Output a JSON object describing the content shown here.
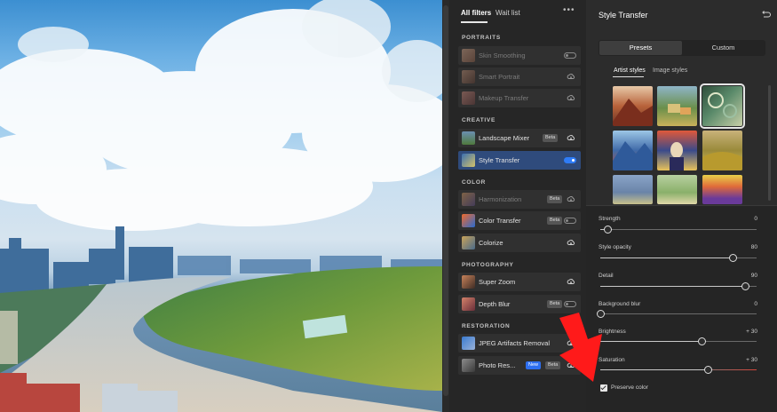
{
  "colors": {
    "accent": "#2f7cf6",
    "arrow": "#ff1a1a",
    "selected_row": "#2f4b7c"
  },
  "filters_panel": {
    "tabs": [
      {
        "label": "All filters",
        "active": true
      },
      {
        "label": "Wait list",
        "active": false
      }
    ],
    "more_icon": "more-horizontal-icon",
    "sections": [
      {
        "title": "PORTRAITS",
        "items": [
          {
            "label": "Skin Smoothing",
            "state": "toggle-off",
            "dim": true
          },
          {
            "label": "Smart Portrait",
            "state": "cloud",
            "dim": true
          },
          {
            "label": "Makeup Transfer",
            "state": "cloud",
            "dim": true
          }
        ]
      },
      {
        "title": "CREATIVE",
        "items": [
          {
            "label": "Landscape Mixer",
            "badge": "Beta",
            "state": "cloud"
          },
          {
            "label": "Style Transfer",
            "state": "toggle-on",
            "selected": true
          }
        ]
      },
      {
        "title": "COLOR",
        "items": [
          {
            "label": "Harmonization",
            "badge": "Beta",
            "state": "cloud",
            "dim": true
          },
          {
            "label": "Color Transfer",
            "badge": "Beta",
            "state": "toggle-off"
          },
          {
            "label": "Colorize",
            "state": "cloud"
          }
        ]
      },
      {
        "title": "PHOTOGRAPHY",
        "items": [
          {
            "label": "Super Zoom",
            "state": "cloud"
          },
          {
            "label": "Depth Blur",
            "badge": "Beta",
            "state": "toggle-off"
          }
        ]
      },
      {
        "title": "RESTORATION",
        "items": [
          {
            "label": "JPEG Artifacts Removal",
            "state": "cloud"
          },
          {
            "label": "Photo Res...",
            "badge": "New",
            "badge2": "Beta",
            "state": "cloud"
          }
        ]
      }
    ]
  },
  "properties": {
    "title": "Style Transfer",
    "reset_icon": "reset-icon",
    "segments": [
      {
        "label": "Presets",
        "active": true
      },
      {
        "label": "Custom",
        "active": false
      }
    ],
    "subtabs": [
      {
        "label": "Artist styles",
        "active": true
      },
      {
        "label": "Image styles",
        "active": false
      }
    ],
    "styles": [
      {
        "name": "red-mountain-style",
        "selected": false
      },
      {
        "name": "impressionist-village-style",
        "selected": false
      },
      {
        "name": "green-swirl-style",
        "selected": true
      },
      {
        "name": "blue-mountain-style",
        "selected": false
      },
      {
        "name": "expressionist-portrait-style",
        "selected": false
      },
      {
        "name": "golden-field-style",
        "selected": false
      },
      {
        "name": "blue-field-style",
        "selected": false
      },
      {
        "name": "meadow-style",
        "selected": false
      },
      {
        "name": "sunset-stripes-style",
        "selected": false
      }
    ],
    "sliders": [
      {
        "label": "Strength",
        "value": "0",
        "fraction": 0.05
      },
      {
        "label": "Style opacity",
        "value": "80",
        "fraction": 0.85
      },
      {
        "label": "Detail",
        "value": "90",
        "fraction": 0.93
      },
      {
        "label": "Background blur",
        "value": "0",
        "fraction": 0.0
      },
      {
        "label": "Brightness",
        "value": "+ 30",
        "fraction": 0.65
      },
      {
        "label": "Saturation",
        "value": "+ 30",
        "fraction": 0.69
      }
    ],
    "preserve_color": {
      "label": "Preserve color",
      "checked": true
    }
  }
}
